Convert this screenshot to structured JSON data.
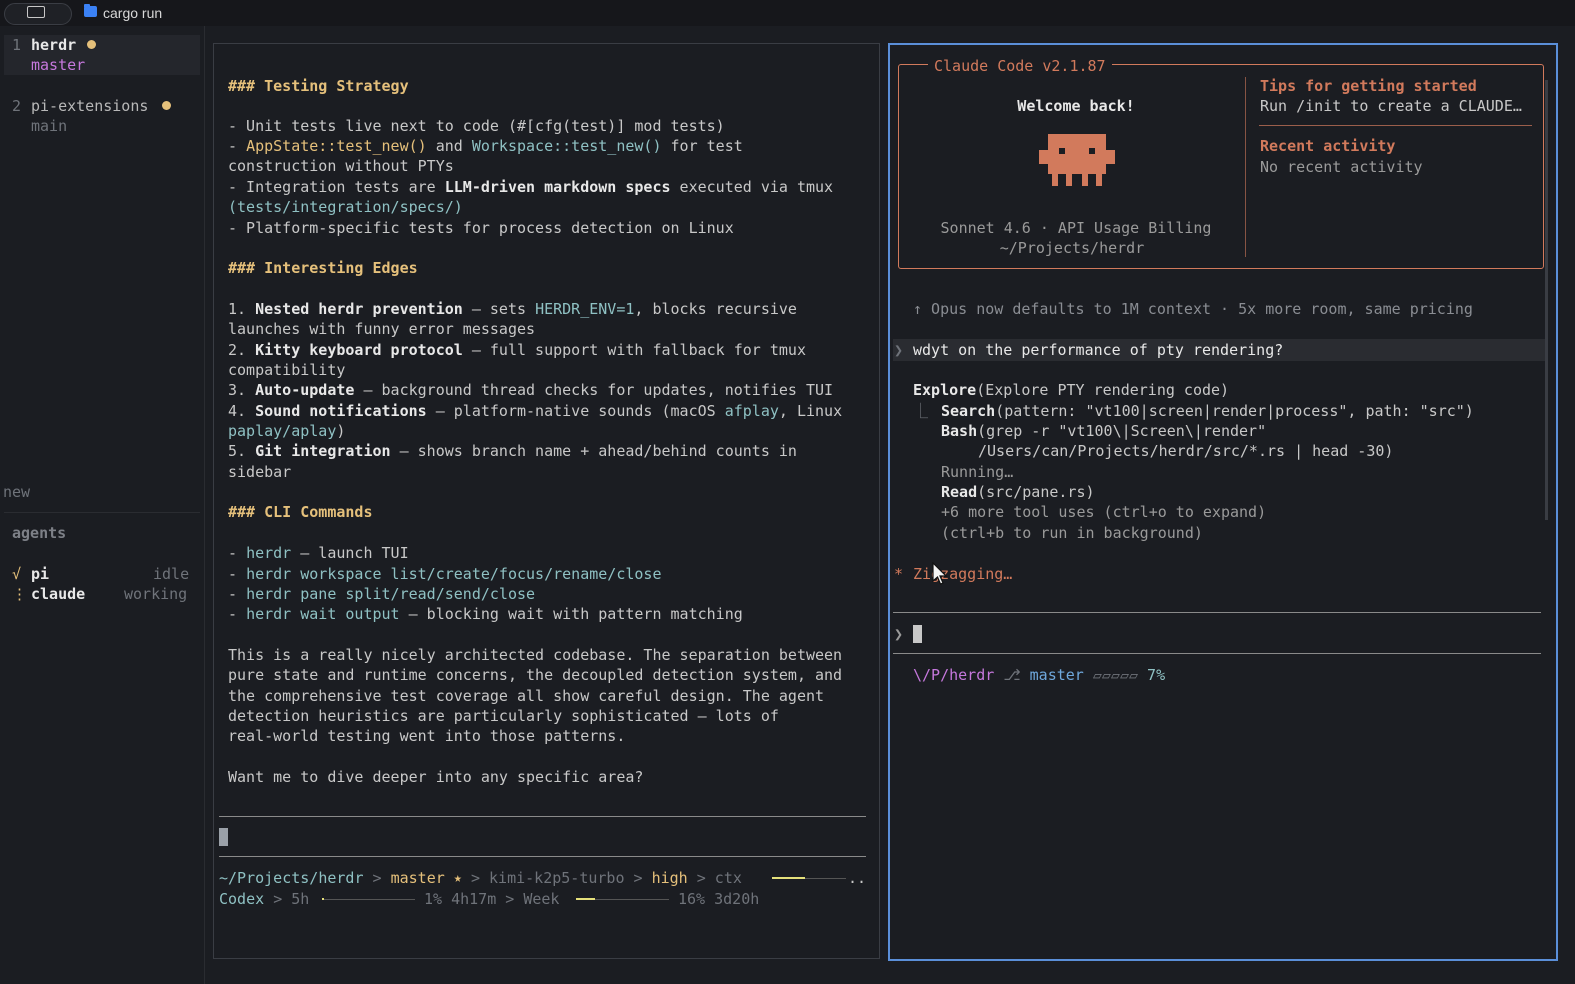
{
  "topbar": {
    "title": "cargo run"
  },
  "sidebar": {
    "workspaces": [
      {
        "index": "1",
        "name": "herdr",
        "branch": "master"
      },
      {
        "index": "2",
        "name": "pi-extensions",
        "branch": "main"
      }
    ],
    "new_label": "new",
    "agents_heading": "agents",
    "agents": [
      {
        "glyph": "√",
        "name": "pi",
        "status": "idle"
      },
      {
        "glyph": "⋮",
        "name": "claude",
        "status": "working"
      }
    ]
  },
  "left_pane": {
    "h_testing": "### Testing Strategy",
    "testing": [
      [
        "- Unit tests live next to code (#[cfg(test)] mod tests)"
      ],
      [
        "- ",
        "AppState::test_new()",
        " and ",
        "Workspace::test_new()",
        " for test"
      ],
      [
        "construction without PTYs"
      ],
      [
        "- Integration tests are ",
        "LLM-driven markdown specs",
        " executed via tmux"
      ],
      [
        "(tests/integration/specs/)"
      ],
      [
        "- Platform-specific tests for process detection on Linux"
      ]
    ],
    "h_edges": "### Interesting Edges",
    "edges": [
      [
        "1. ",
        "Nested herdr prevention",
        " — sets ",
        "HERDR_ENV=1",
        ", blocks recursive"
      ],
      [
        "launches with funny error messages"
      ],
      [
        "2. ",
        "Kitty keyboard protocol",
        " — full support with fallback for tmux"
      ],
      [
        "compatibility"
      ],
      [
        "3. ",
        "Auto-update",
        " — background thread checks for updates, notifies TUI"
      ],
      [
        "4. ",
        "Sound notifications",
        " — platform-native sounds (macOS ",
        "afplay",
        ", Linux"
      ],
      [
        "paplay/aplay",
        ")"
      ],
      [
        "5. ",
        "Git integration",
        " — shows branch name + ahead/behind counts in"
      ],
      [
        "sidebar"
      ]
    ],
    "h_cli": "### CLI Commands",
    "cli": [
      [
        "- ",
        "herdr",
        " — launch TUI"
      ],
      [
        "- ",
        "herdr workspace list/create/focus/rename/close"
      ],
      [
        "- ",
        "herdr pane split/read/send/close"
      ],
      [
        "- ",
        "herdr wait output",
        " — blocking wait with pattern matching"
      ]
    ],
    "summary": [
      "This is a really nicely architected codebase. The separation between",
      "pure state and runtime concerns, the decoupled detection system, and",
      "the comprehensive test coverage all show careful design. The agent",
      "detection heuristics are particularly sophisticated — lots of",
      "real-world testing went into those patterns."
    ],
    "question": "Want me to dive deeper into any specific area?",
    "status1": {
      "path": "~/Projects/herdr",
      "sep": ">",
      "branch": "master ⭑",
      "model": "kimi-k2p5-turbo",
      "effort": "high",
      "ctx": "ctx",
      "ellipsis": ".."
    },
    "status2": {
      "name": "Codex",
      "sep": ">",
      "window1": "5h",
      "pct1": "1%",
      "reset1": "4h17m",
      "window2": "Week",
      "pct2": "16%",
      "reset2": "3d20h"
    },
    "ctx_fill": 0.45,
    "usage_5h_fill": 0.01,
    "usage_week_fill": 0.2
  },
  "right_pane": {
    "title": "Claude Code v2.1.87",
    "welcome": "Welcome back!",
    "model_line": "Sonnet 4.6 · API Usage Billing",
    "cwd": "~/Projects/herdr",
    "tips_heading": "Tips for getting started",
    "tips_text": "Run /init to create a CLAUDE…",
    "recent_heading": "Recent activity",
    "recent_text": "No recent activity",
    "notice": "↑ Opus now defaults to 1M context · 5x more room, same pricing",
    "prompt_glyph": "❯",
    "user_prompt": "wdyt on the performance of pty rendering?",
    "explore_name": "Explore",
    "explore_args": "(Explore PTY rendering code)",
    "tree_glyph": "⎿",
    "tool1_name": "Search",
    "tool1_args": "(pattern: \"vt100|screen|render|process\", path: \"src\")",
    "tool2_name": "Bash",
    "tool2_args": "(grep -r \"vt100\\|Screen\\|render\"",
    "tool2_args_cont": "/Users/can/Projects/herdr/src/*.rs | head -30)",
    "running": "Running…",
    "tool3_name": "Read",
    "tool3_args": "(src/pane.rs)",
    "more_tools": "+6 more tool uses (ctrl+o to expand)",
    "background_hint": "(ctrl+b to run in background)",
    "spinner_glyph": "*",
    "spinner_text": "Zigzagging…",
    "input_glyph": "❯",
    "status_path": "\\/P/herdr",
    "status_branch_icon": "⎇",
    "status_branch": "master",
    "status_meter": "▱▱▱▱▱",
    "status_pct": "7%"
  },
  "colors": {
    "background": "#1b1d22",
    "accent_orange": "#d27a5c",
    "heading_yellow": "#e5c07b",
    "code_cyan": "#8fc1c3",
    "branch_purple": "#c678dd",
    "focus_border": "#5b8fd9"
  },
  "icons": [
    "terminal-icon",
    "folder-icon",
    "mascot-icon",
    "mouse-pointer-icon"
  ]
}
